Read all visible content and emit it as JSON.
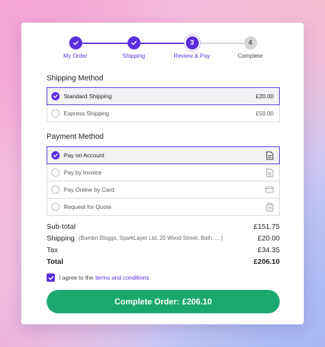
{
  "stepper": {
    "steps": [
      {
        "label": "My Order",
        "number": "1",
        "state": "done"
      },
      {
        "label": "Shipping",
        "number": "2",
        "state": "done"
      },
      {
        "label": "Review & Pay",
        "number": "3",
        "state": "current"
      },
      {
        "label": "Complete",
        "number": "4",
        "state": "pending"
      }
    ]
  },
  "shipping": {
    "title": "Shipping Method",
    "options": [
      {
        "label": "Standard Shipping",
        "price": "£20.00",
        "selected": true
      },
      {
        "label": "Express Shipping",
        "price": "£50.00",
        "selected": false
      }
    ]
  },
  "payment": {
    "title": "Payment Method",
    "options": [
      {
        "label": "Pay on Account",
        "icon": "document-icon",
        "selected": true
      },
      {
        "label": "Pay by Invoice",
        "icon": "invoice-icon",
        "selected": false
      },
      {
        "label": "Pay Online by Card",
        "icon": "credit-card-icon",
        "selected": false
      },
      {
        "label": "Request for Quote",
        "icon": "clipboard-icon",
        "selected": false
      }
    ]
  },
  "summary": {
    "subtotal_label": "Sub-total",
    "subtotal_value": "£151.75",
    "shipping_label": "Shipping",
    "shipping_address": "(Bambri Bloggs, SparkLayer Ltd, 20 Wood Street, Bath, ...",
    "shipping_address_close": ")",
    "shipping_value": "£20.00",
    "tax_label": "Tax",
    "tax_value": "£34.35",
    "total_label": "Total",
    "total_value": "£206.10"
  },
  "agreement": {
    "text": "I agree to the",
    "link": "terms and conditions",
    "checked": true
  },
  "cta": {
    "label": "Complete Order:",
    "amount": "£206.10"
  },
  "colors": {
    "accent": "#5b2ee0",
    "cta": "#1aa86f",
    "pending": "#d6d6d6"
  }
}
